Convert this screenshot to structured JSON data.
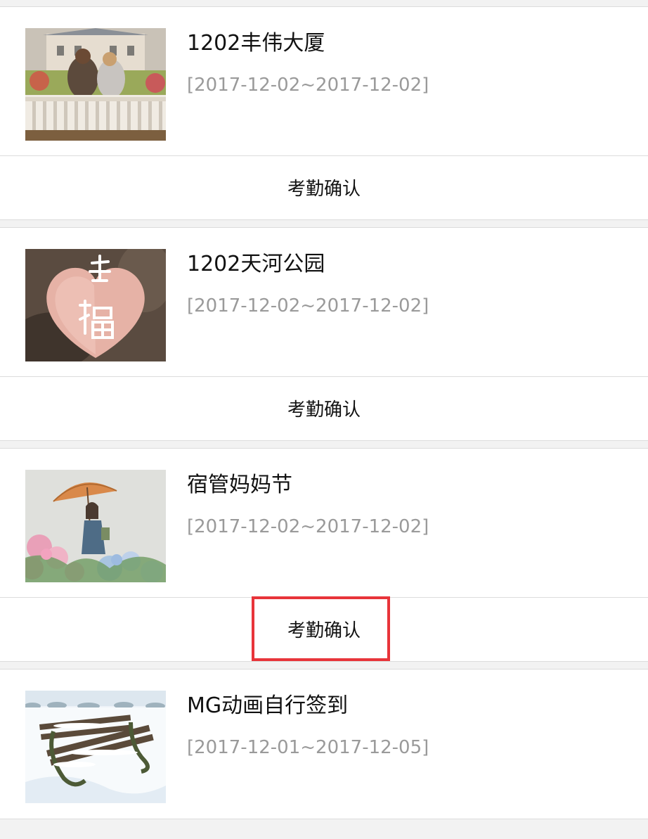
{
  "items": [
    {
      "title": "1202丰伟大厦",
      "date_range": "[2017-12-02~2017-12-02]",
      "action_label": "考勤确认",
      "thumbnail": "couple-on-bench-image"
    },
    {
      "title": "1202天河公园",
      "date_range": "[2017-12-02~2017-12-02]",
      "action_label": "考勤确认",
      "thumbnail": "heart-stone-image"
    },
    {
      "title": "宿管妈妈节",
      "date_range": "[2017-12-02~2017-12-02]",
      "action_label": "考勤确认",
      "thumbnail": "girl-with-umbrella-image"
    },
    {
      "title": "MG动画自行签到",
      "date_range": "[2017-12-01~2017-12-05]",
      "thumbnail": "snowy-bench-image"
    }
  ],
  "colors": {
    "highlight": "#e8343a",
    "date_text": "#9a9a9a",
    "separator": "#f2f2f2"
  }
}
